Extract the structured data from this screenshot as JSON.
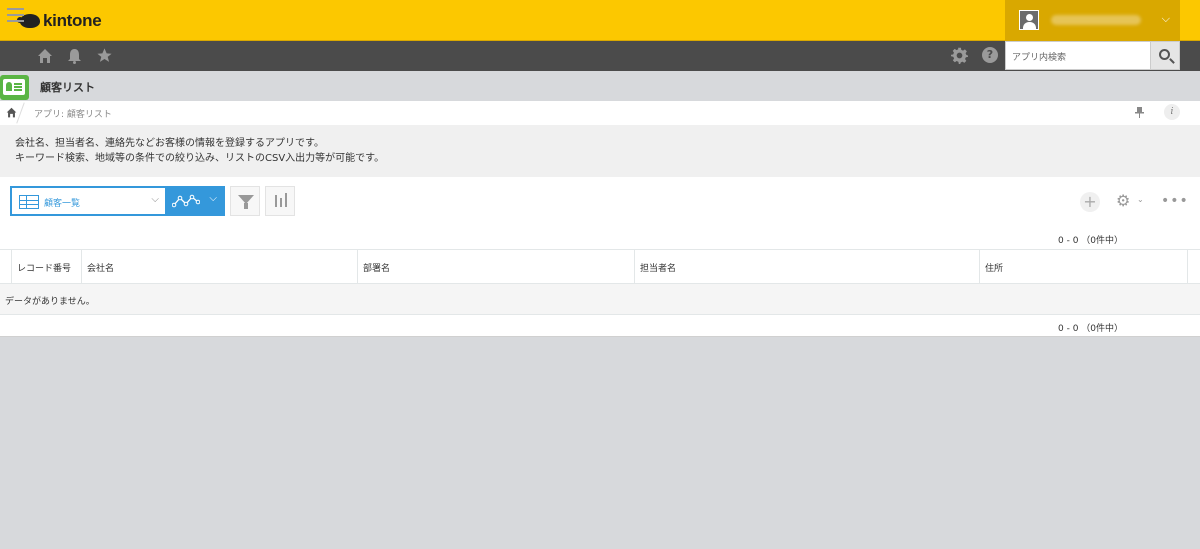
{
  "header": {
    "logo_text": "kintone",
    "user_chevron": "⌵",
    "brand_color": "#fcc800"
  },
  "navbar": {
    "icons": [
      "menu-icon",
      "home-icon",
      "bell-icon",
      "star-icon",
      "gear-icon",
      "help-icon"
    ],
    "help_glyph": "?",
    "search_placeholder": "アプリ内検索"
  },
  "app": {
    "title": "顧客リスト",
    "breadcrumb": "アプリ: 顧客リスト",
    "description_line1": "会社名、担当者名、連絡先などお客様の情報を登録するアプリです。",
    "description_line2": "キーワード検索、地域等の条件での絞り込み、リストのCSV入出力等が可能です。"
  },
  "toolbar": {
    "view_label": "顧客一覧",
    "view_chevron": "⌵",
    "graph_chevron": "⌵",
    "accent_color": "#3498db",
    "add_glyph": "+",
    "settings_glyph": "⚙",
    "settings_chevron": "⌄",
    "more_glyph": "•••"
  },
  "pager": {
    "top": "0 - 0 （0件中）",
    "bottom": "0 - 0 （0件中）"
  },
  "table": {
    "columns": [
      "レコード番号",
      "会社名",
      "部署名",
      "担当者名",
      "住所"
    ],
    "empty_message": "データがありません。"
  }
}
